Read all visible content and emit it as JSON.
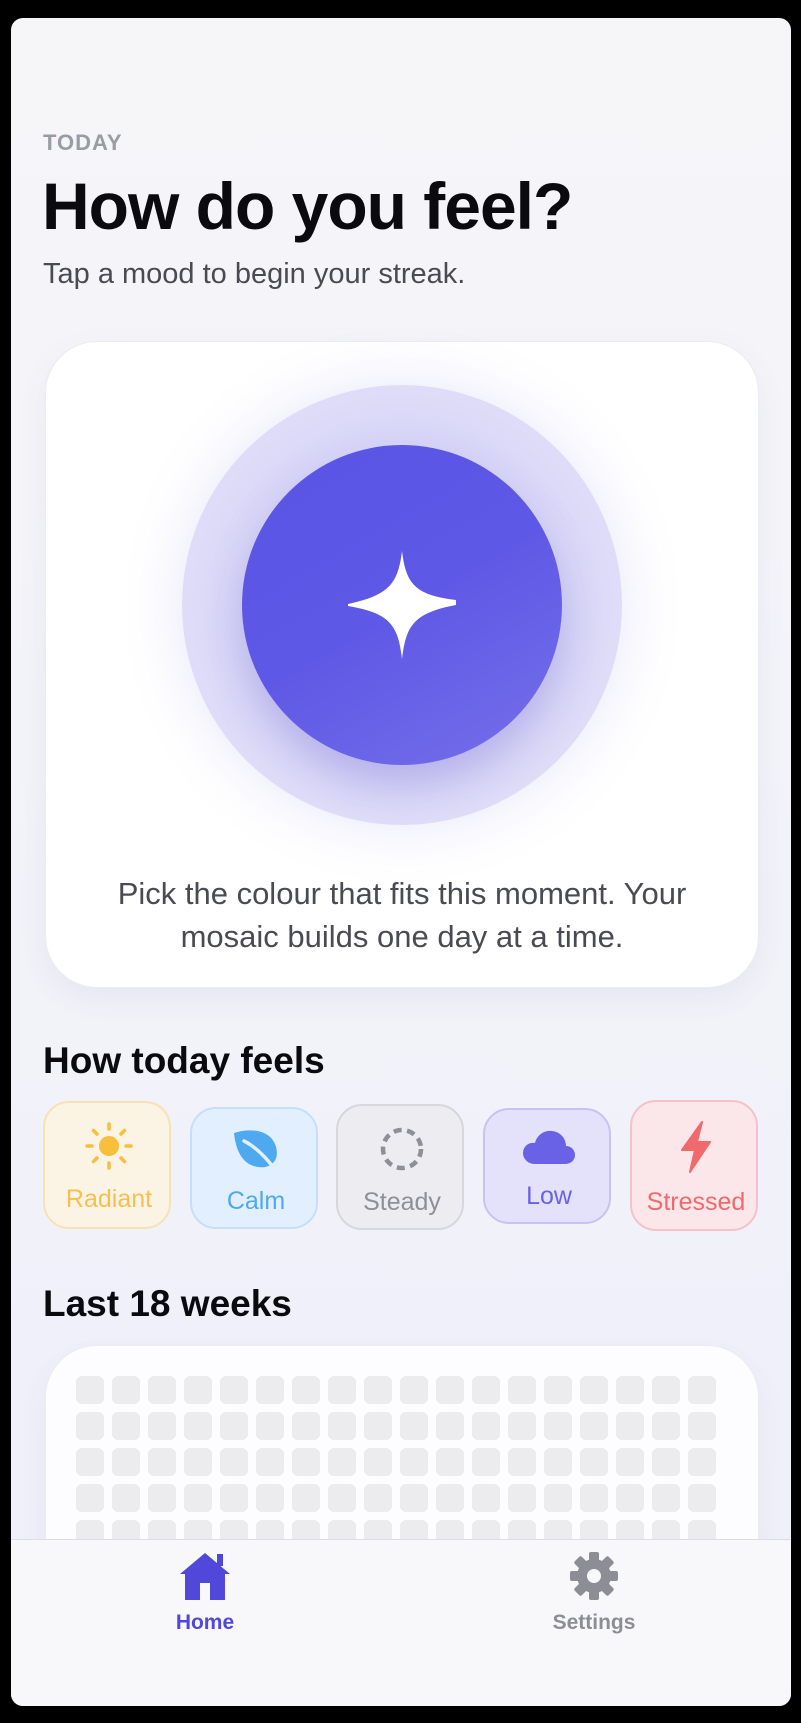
{
  "header": {
    "eyebrow": "TODAY",
    "title": "How do you feel?",
    "subtitle": "Tap a mood to begin your streak."
  },
  "hero": {
    "icon": "sparkle-icon",
    "caption": "Pick the colour that fits this moment. Your mosaic builds one day at a time."
  },
  "moods_section": {
    "title": "How today feels",
    "items": [
      {
        "label": "Radiant",
        "icon": "sun-icon",
        "color": "#f5c050"
      },
      {
        "label": "Calm",
        "icon": "leaf-icon",
        "color": "#4ea9ee"
      },
      {
        "label": "Steady",
        "icon": "dashed-circle-icon",
        "color": "#8e8f98"
      },
      {
        "label": "Low",
        "icon": "cloud-icon",
        "color": "#6a62e6"
      },
      {
        "label": "Stressed",
        "icon": "lightning-icon",
        "color": "#f0696c"
      }
    ]
  },
  "history_section": {
    "title": "Last 18 weeks"
  },
  "tabbar": {
    "home_label": "Home",
    "settings_label": "Settings",
    "active_tab": "Home"
  },
  "colors": {
    "accent": "#5a54e6",
    "inactive": "#8d8e95"
  }
}
